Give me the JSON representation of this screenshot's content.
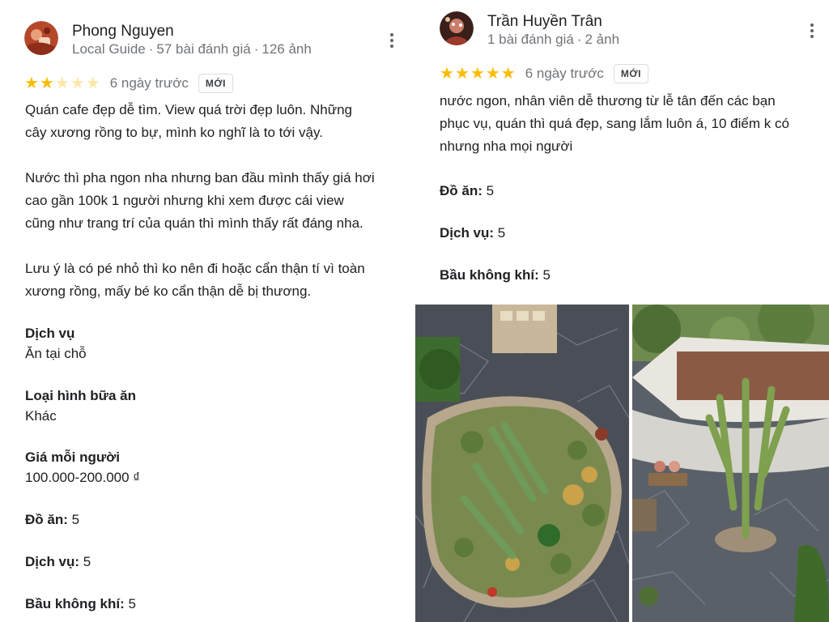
{
  "left_review": {
    "author": "Phong Nguyen",
    "guide_label": "Local Guide",
    "review_count": "57 bài đánh giá",
    "photo_count": "126 ảnh",
    "rating": 2,
    "time": "6 ngày trước",
    "badge": "MỚI",
    "body": "Quán cafe đẹp dễ tìm. View quá trời đẹp luôn. Những\ncây xương rồng to bự, mình ko nghĩ là to tới vậy.\n\nNước thì pha ngon nha nhưng  ban đầu mình thấy giá hơi\ncao gần 100k 1 người nhưng khi xem được cái view\ncũng như trang trí của quán thì mình thấy rất đáng nha.\n\nLưu ý là có pé nhỏ thì ko nên đi hoặc cẩn thận tí vì toàn\nxương rồng, mấy bé ko cẩn thận dễ bị thương.",
    "service_label": "Dịch vụ",
    "service_value": "Ăn tại chỗ",
    "meal_label": "Loại hình bữa ăn",
    "meal_value": "Khác",
    "price_label": "Giá mỗi người",
    "price_value": "100.000-200.000 ₫",
    "food_label": "Đồ ăn:",
    "food_value": " 5",
    "svc_label": "Dịch vụ:",
    "svc_value": " 5",
    "atmo_label": "Bầu không khí:",
    "atmo_value": " 5"
  },
  "right_review": {
    "author": "Trần Huyền Trân",
    "review_count": "1 bài đánh giá",
    "photo_count": "2 ảnh",
    "rating": 5,
    "time": "6 ngày trước",
    "badge": "MỚI",
    "body": "nước ngon, nhân viên dễ thương từ lễ tân đến các bạn\nphục vụ, quán thì quá đẹp, sang lắm luôn á, 10 điểm k có\nnhưng nha mọi người",
    "food_label": "Đồ ăn:",
    "food_value": " 5",
    "svc_label": "Dịch vụ:",
    "svc_value": " 5",
    "atmo_label": "Bầu không khí:",
    "atmo_value": " 5",
    "photos": [
      "cactus-garden-photo",
      "tall-cactus-terrace-photo"
    ]
  },
  "colors": {
    "star": "#fbbc04",
    "meta": "#70757a",
    "text": "#202124"
  },
  "icons": [
    "more-vert-icon",
    "star-icon"
  ]
}
